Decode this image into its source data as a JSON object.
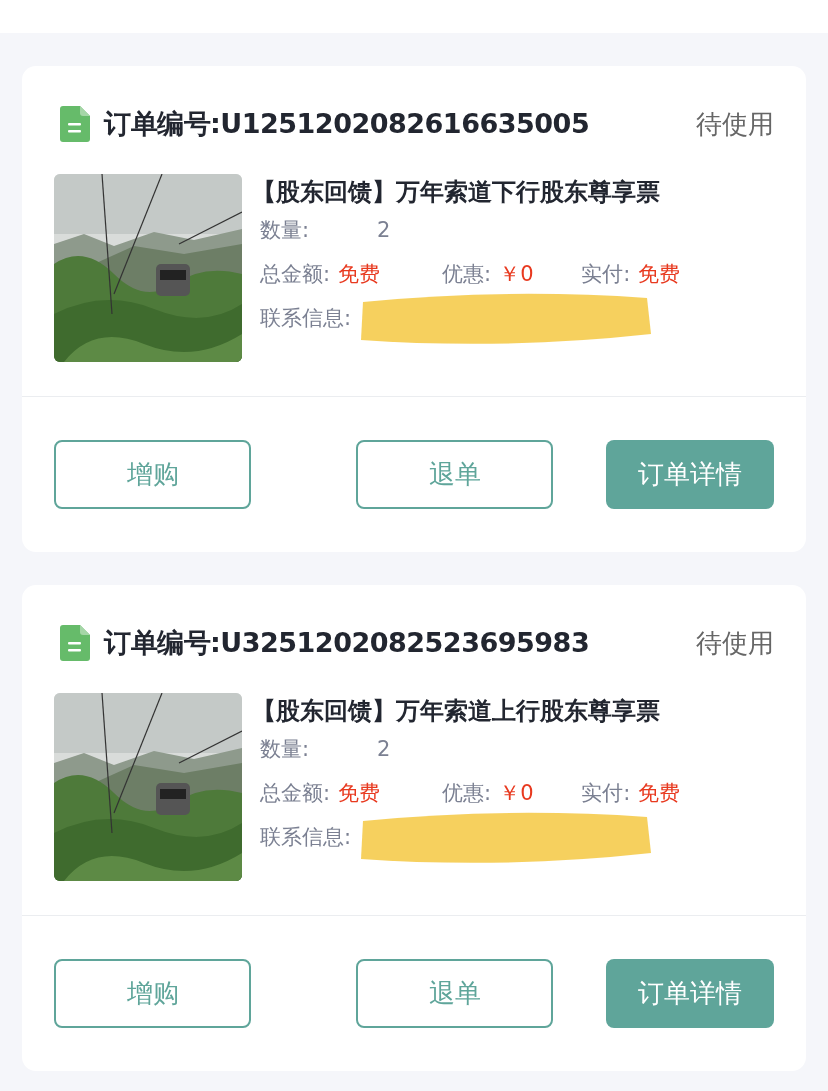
{
  "orders": [
    {
      "order_label": "订单编号:U1251202082616635005",
      "status": "待使用",
      "title": "【股东回馈】万年索道下行股东尊享票",
      "quantity_label": "数量:",
      "quantity": "2",
      "total_label": "总金额:",
      "total": "免费",
      "discount_label": "优惠:",
      "discount": "￥0",
      "paid_label": "实付:",
      "paid": "免费",
      "contact_label": "联系信息:",
      "contact_redacted": true,
      "buttons": [
        {
          "label": "增购",
          "kind": "outline"
        },
        {
          "label": "退单",
          "kind": "outline"
        },
        {
          "label": "订单详情",
          "kind": "primary"
        }
      ]
    },
    {
      "order_label": "订单编号:U3251202082523695983",
      "status": "待使用",
      "title": "【股东回馈】万年索道上行股东尊享票",
      "quantity_label": "数量:",
      "quantity": "2",
      "total_label": "总金额:",
      "total": "免费",
      "discount_label": "优惠:",
      "discount": "￥0",
      "paid_label": "实付:",
      "paid": "免费",
      "contact_label": "联系信息:",
      "contact_redacted": true,
      "buttons": [
        {
          "label": "增购",
          "kind": "outline"
        },
        {
          "label": "退单",
          "kind": "outline"
        },
        {
          "label": "订单详情",
          "kind": "primary"
        }
      ]
    }
  ]
}
